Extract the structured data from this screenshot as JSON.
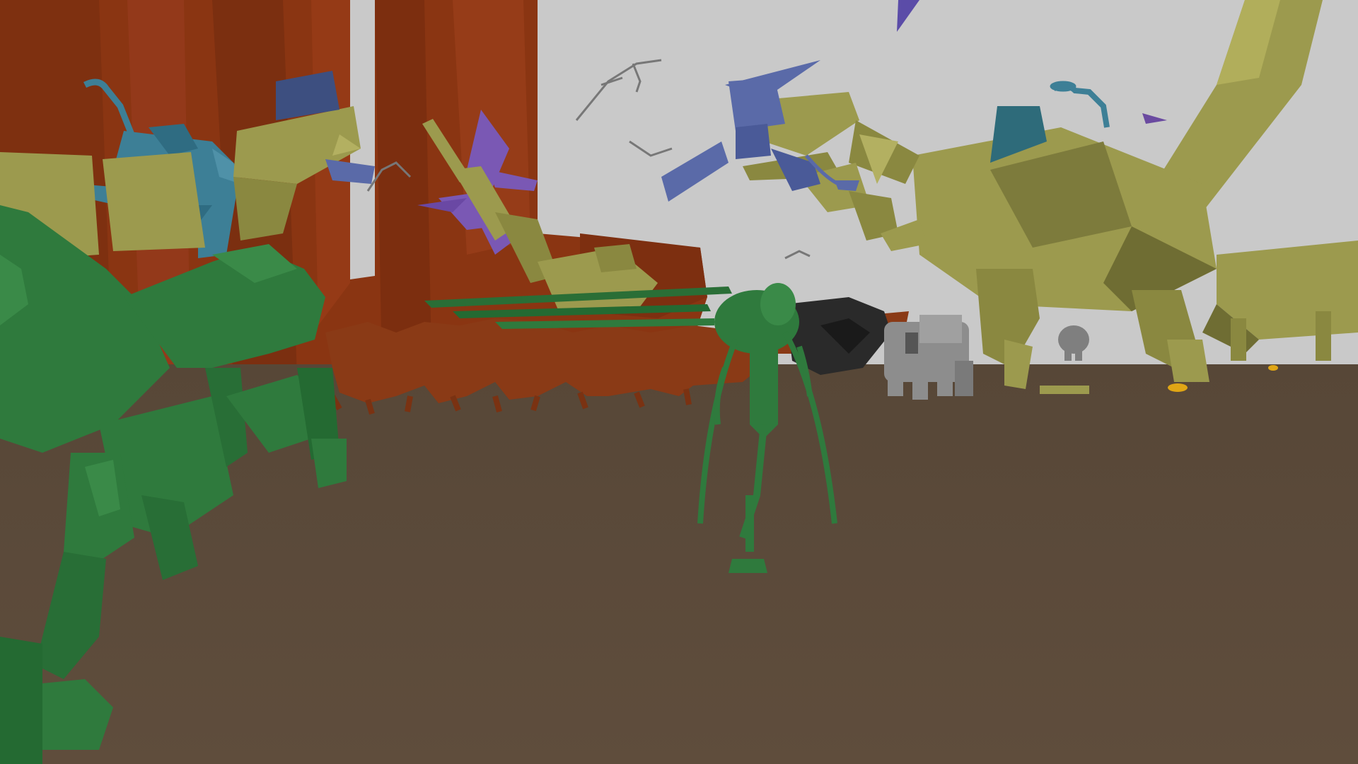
{
  "scene": {
    "palette": {
      "sky": "#c9c9c9",
      "ground_far": "#5a4a3d",
      "ground_near": "#5e4c3b",
      "cliff": "#8a3512",
      "cliff_shadow": "#6e2a0e",
      "olive_creature": "#9c9a4e",
      "olive_shadow": "#6f6d33",
      "green_creature": "#2f7a3d",
      "green_shadow": "#1f5a2a",
      "teal_creature": "#3d7f96",
      "blue_flyer": "#5a6aa8",
      "purple_flyer": "#7a58b4",
      "rust_herd": "#8a3a16",
      "gray_creature": "#8d8d8d",
      "dark_creature": "#2a2a2a",
      "gold_item": "#e0a615"
    },
    "entities": [
      {
        "name": "giant-olive-creature",
        "color": "olive_creature"
      },
      {
        "name": "small-olive-creature",
        "color": "olive_creature"
      },
      {
        "name": "left-olive-creature",
        "color": "olive_creature"
      },
      {
        "name": "center-olive-creature",
        "color": "olive_creature"
      },
      {
        "name": "foreground-green-creature",
        "color": "green_creature"
      },
      {
        "name": "green-insect-creature",
        "color": "green_creature"
      },
      {
        "name": "teal-spiky-creature",
        "color": "teal_creature"
      },
      {
        "name": "teal-small-creature",
        "color": "teal_creature"
      },
      {
        "name": "blue-flying-creature",
        "color": "blue_flyer"
      },
      {
        "name": "purple-flying-creature",
        "color": "purple_flyer"
      },
      {
        "name": "rust-creature-herd",
        "color": "rust_herd"
      },
      {
        "name": "gray-stone-creature",
        "color": "gray_creature"
      },
      {
        "name": "dark-creature",
        "color": "dark_creature"
      },
      {
        "name": "gray-flying-insect",
        "color": "gray_creature"
      },
      {
        "name": "gold-item",
        "color": "gold_item"
      }
    ]
  }
}
